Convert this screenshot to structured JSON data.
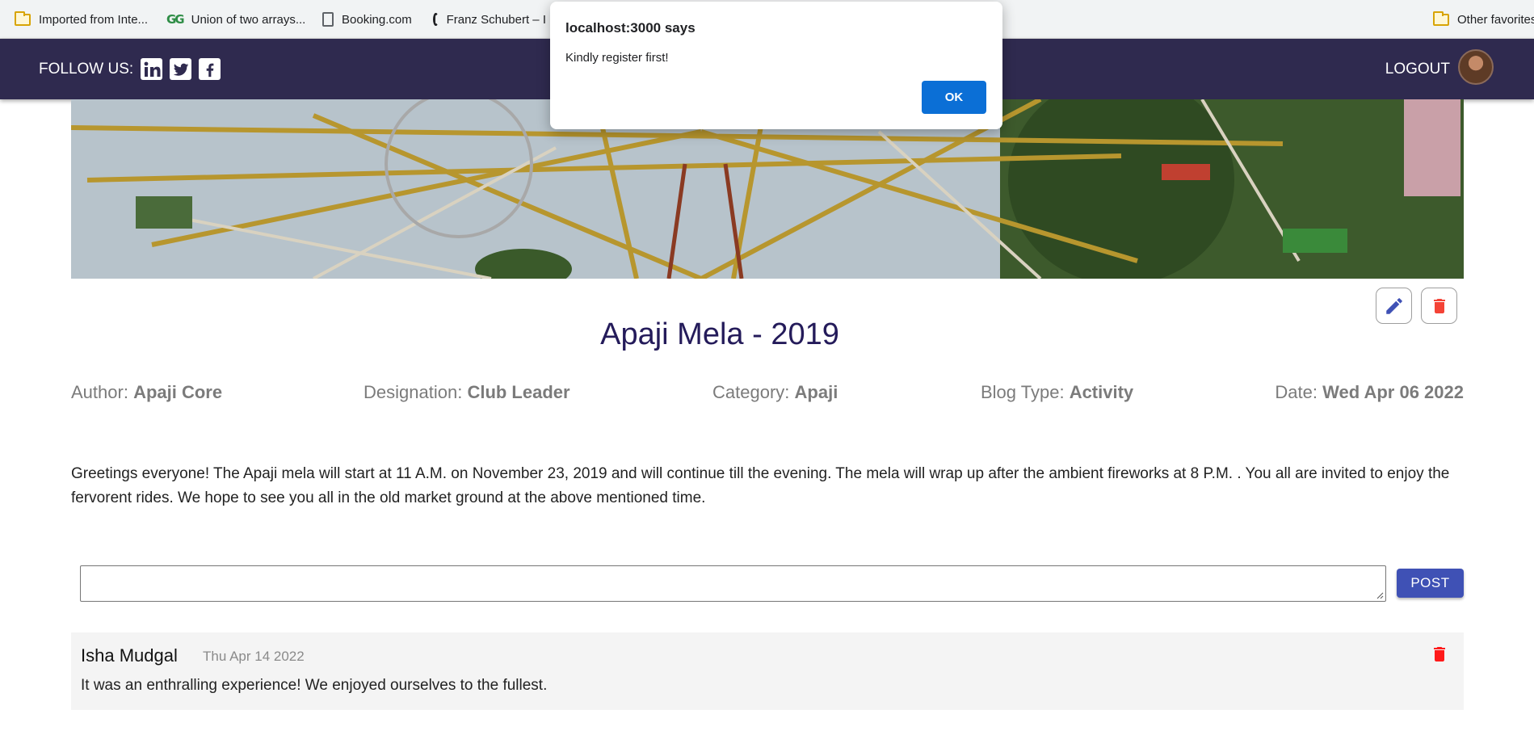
{
  "bookmarks": [
    {
      "label": "Imported from Inte...",
      "icon": "folder-icon"
    },
    {
      "label": "Union of two arrays...",
      "icon": "geeksforgeeks-icon"
    },
    {
      "label": "Booking.com",
      "icon": "page-icon"
    },
    {
      "label": "Franz Schubert – I",
      "icon": "moon-icon"
    },
    {
      "label": "Other favorites",
      "icon": "folder-icon"
    }
  ],
  "navbar": {
    "follow_label": "FOLLOW US:",
    "social": [
      "linkedin-icon",
      "twitter-icon",
      "facebook-icon"
    ],
    "logout_label": "LOGOUT",
    "background": "#2f2a4f"
  },
  "post": {
    "title": "Apaji Mela - 2019",
    "meta": {
      "author_label": "Author:",
      "author": "Apaji Core",
      "designation_label": "Designation:",
      "designation": "Club Leader",
      "category_label": "Category:",
      "category": "Apaji",
      "type_label": "Blog Type:",
      "type": "Activity",
      "date_label": "Date:",
      "date": "Wed Apr 06 2022"
    },
    "body": "Greetings everyone! The Apaji mela will start at 11 A.M. on November 23, 2019 and will continue till the evening. The mela will wrap up after the ambient fireworks at 8 P.M. . You all are invited to enjoy the fervorent rides. We hope to see you all in the old market ground at the above mentioned time."
  },
  "comment_form": {
    "value": "",
    "post_label": "POST",
    "button_color": "#3f51b5"
  },
  "comments": [
    {
      "author": "Isha Mudgal",
      "date": "Thu Apr 14 2022",
      "text": "It was an enthralling experience! We enjoyed ourselves to the fullest."
    }
  ],
  "dialog": {
    "title": "localhost:3000 says",
    "message": "Kindly register first!",
    "ok_label": "OK"
  },
  "colors": {
    "title": "#241b5a",
    "edit_icon": "#3f51b5",
    "delete_icon": "#f44336"
  }
}
